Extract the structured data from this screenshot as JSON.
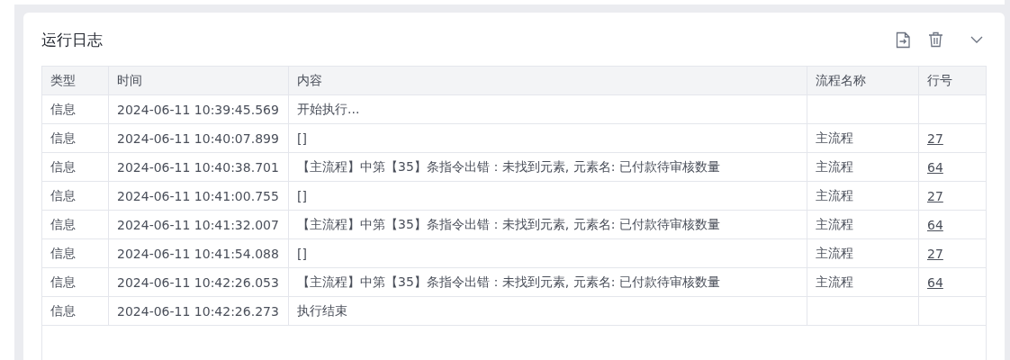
{
  "panel": {
    "title": "运行日志"
  },
  "table": {
    "columns": [
      "类型",
      "时间",
      "内容",
      "流程名称",
      "行号"
    ],
    "rows": [
      {
        "type": "信息",
        "time": "2024-06-11 10:39:45.569",
        "content": "开始执行...",
        "flow": "",
        "line": ""
      },
      {
        "type": "信息",
        "time": "2024-06-11 10:40:07.899",
        "content": "[]",
        "flow": "主流程",
        "line": "27"
      },
      {
        "type": "信息",
        "time": "2024-06-11 10:40:38.701",
        "content": "【主流程】中第【35】条指令出错：未找到元素, 元素名: 已付款待审核数量",
        "flow": "主流程",
        "line": "64"
      },
      {
        "type": "信息",
        "time": "2024-06-11 10:41:00.755",
        "content": "[]",
        "flow": "主流程",
        "line": "27"
      },
      {
        "type": "信息",
        "time": "2024-06-11 10:41:32.007",
        "content": "【主流程】中第【35】条指令出错：未找到元素, 元素名: 已付款待审核数量",
        "flow": "主流程",
        "line": "64"
      },
      {
        "type": "信息",
        "time": "2024-06-11 10:41:54.088",
        "content": "[]",
        "flow": "主流程",
        "line": "27"
      },
      {
        "type": "信息",
        "time": "2024-06-11 10:42:26.053",
        "content": "【主流程】中第【35】条指令出错：未找到元素, 元素名: 已付款待审核数量",
        "flow": "主流程",
        "line": "64"
      },
      {
        "type": "信息",
        "time": "2024-06-11 10:42:26.273",
        "content": "执行结束",
        "flow": "",
        "line": ""
      }
    ]
  }
}
